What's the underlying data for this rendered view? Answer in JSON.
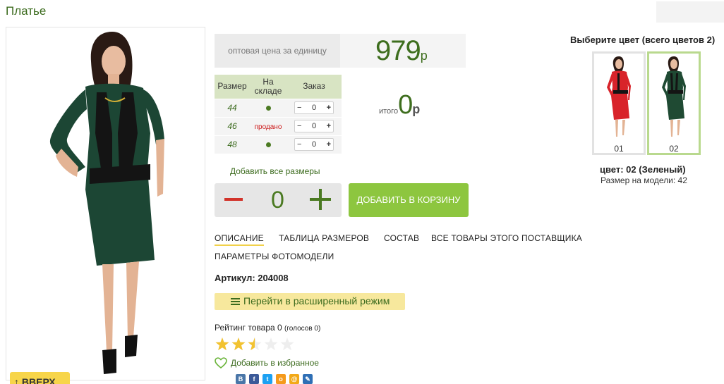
{
  "page": {
    "title": "Платье"
  },
  "price": {
    "label": "оптовая цена за единицу",
    "value": "979",
    "currency": "р"
  },
  "size_table": {
    "headers": [
      "Размер",
      "На складе",
      "Заказ"
    ],
    "rows": [
      {
        "size": "44",
        "stock": "dot",
        "stock_text": "",
        "qty": "0"
      },
      {
        "size": "46",
        "stock": "sold",
        "stock_text": "продано",
        "qty": "0"
      },
      {
        "size": "48",
        "stock": "dot",
        "stock_text": "",
        "qty": "0"
      }
    ],
    "minus": "−",
    "plus": "+"
  },
  "total": {
    "label": "итого",
    "value": "0",
    "currency": "р"
  },
  "add_all_sizes": "Добавить все размеры",
  "quantity": {
    "value": "0"
  },
  "add_to_cart": "ДОБАВИТЬ В КОРЗИНУ",
  "tabs": [
    {
      "label": "ОПИСАНИЕ",
      "active": true
    },
    {
      "label": "ТАБЛИЦА РАЗМЕРОВ",
      "active": false
    },
    {
      "label": "СОСТАВ",
      "active": false
    },
    {
      "label": "ВСЕ ТОВАРЫ ЭТОГО ПОСТАВЩИКА",
      "active": false
    },
    {
      "label": "ПАРАМЕТРЫ ФОТОМОДЕЛИ",
      "active": false
    }
  ],
  "sku": "Артикул: 204008",
  "extended_mode": "Перейти в расширенный режим",
  "rating": {
    "label": "Рейтинг товара 0",
    "votes": "(голосов 0)",
    "stars_filled": 2.5,
    "stars_total": 5
  },
  "favorite": "Добавить в избранное",
  "social": [
    "В",
    "f",
    "t",
    "о",
    "@",
    "✎"
  ],
  "colors": {
    "title": "Выберите цвет (всего цветов 2)",
    "options": [
      {
        "num": "01",
        "color": "#d8232a",
        "selected": false
      },
      {
        "num": "02",
        "color": "#1f4a33",
        "selected": true
      }
    ],
    "current": "цвет: 02 (Зеленый)",
    "model_size": "Размер на модели: 42"
  },
  "up_button": "ВВЕРХ",
  "accent": {
    "green": "#3e6e1e",
    "cart": "#8dc63f",
    "yellow": "#f7e89d"
  }
}
